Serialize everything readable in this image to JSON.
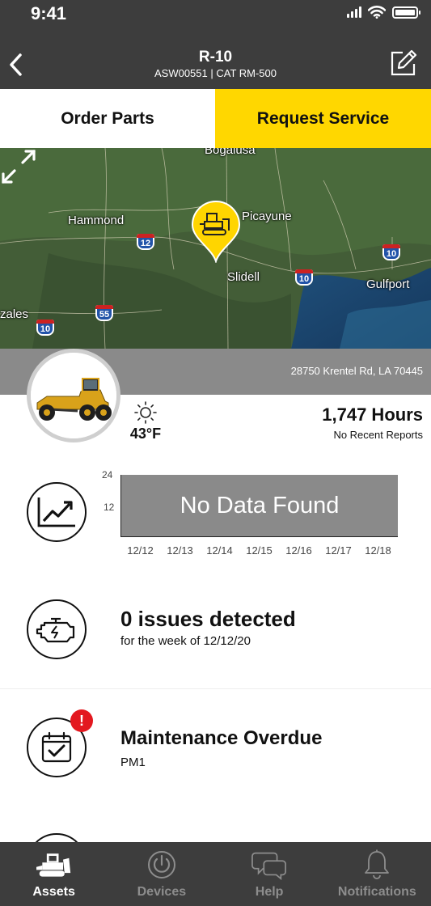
{
  "status_bar": {
    "time": "9:41"
  },
  "header": {
    "title": "R-10",
    "subtitle": "ASW00551 | CAT RM-500"
  },
  "actions": {
    "order_parts": "Order Parts",
    "request_service": "Request Service"
  },
  "map": {
    "labels": {
      "bogalusa": "Bogalusa",
      "hammond": "Hammond",
      "picayune": "Picayune",
      "slidell": "Slidell",
      "gulfport": "Gulfport",
      "gonzales": "zales"
    },
    "shields": {
      "i12": "12",
      "i10a": "10",
      "i10b": "10",
      "i10c": "10",
      "i55": "55"
    }
  },
  "asset": {
    "address": "28750 Krentel Rd, LA 70445"
  },
  "weather": {
    "icon": "sun-icon",
    "temperature": "43°F"
  },
  "hours": {
    "value": "1,747 Hours",
    "note": "No Recent Reports"
  },
  "usage_chart": {
    "icon": "trend-chart-icon",
    "y_labels": [
      "24",
      "12"
    ],
    "empty_text": "No Data Found",
    "x_labels": [
      "12/12",
      "12/13",
      "12/14",
      "12/15",
      "12/16",
      "12/17",
      "12/18"
    ]
  },
  "chart_data": {
    "type": "bar",
    "categories": [
      "12/12",
      "12/13",
      "12/14",
      "12/15",
      "12/16",
      "12/17",
      "12/18"
    ],
    "values": [],
    "ylim": [
      0,
      24
    ],
    "yticks": [
      12,
      24
    ],
    "placeholder": "No Data Found"
  },
  "issues": {
    "icon": "engine-icon",
    "title": "0 issues detected",
    "subtitle": "for the week of 12/12/20"
  },
  "maintenance": {
    "icon": "calendar-check-icon",
    "badge": "!",
    "title": "Maintenance Overdue",
    "subtitle": "PM1"
  },
  "tabbar": {
    "tabs": [
      {
        "label": "Assets",
        "icon": "bulldozer-icon",
        "active": true
      },
      {
        "label": "Devices",
        "icon": "power-icon",
        "active": false
      },
      {
        "label": "Help",
        "icon": "chat-bubbles-icon",
        "active": false
      },
      {
        "label": "Notifications",
        "icon": "bell-icon",
        "active": false
      }
    ]
  },
  "colors": {
    "header_bg": "#3d3d3d",
    "accent_yellow": "#ffd700",
    "alert_red": "#e3181f",
    "chart_gray": "#8a8a8a"
  }
}
